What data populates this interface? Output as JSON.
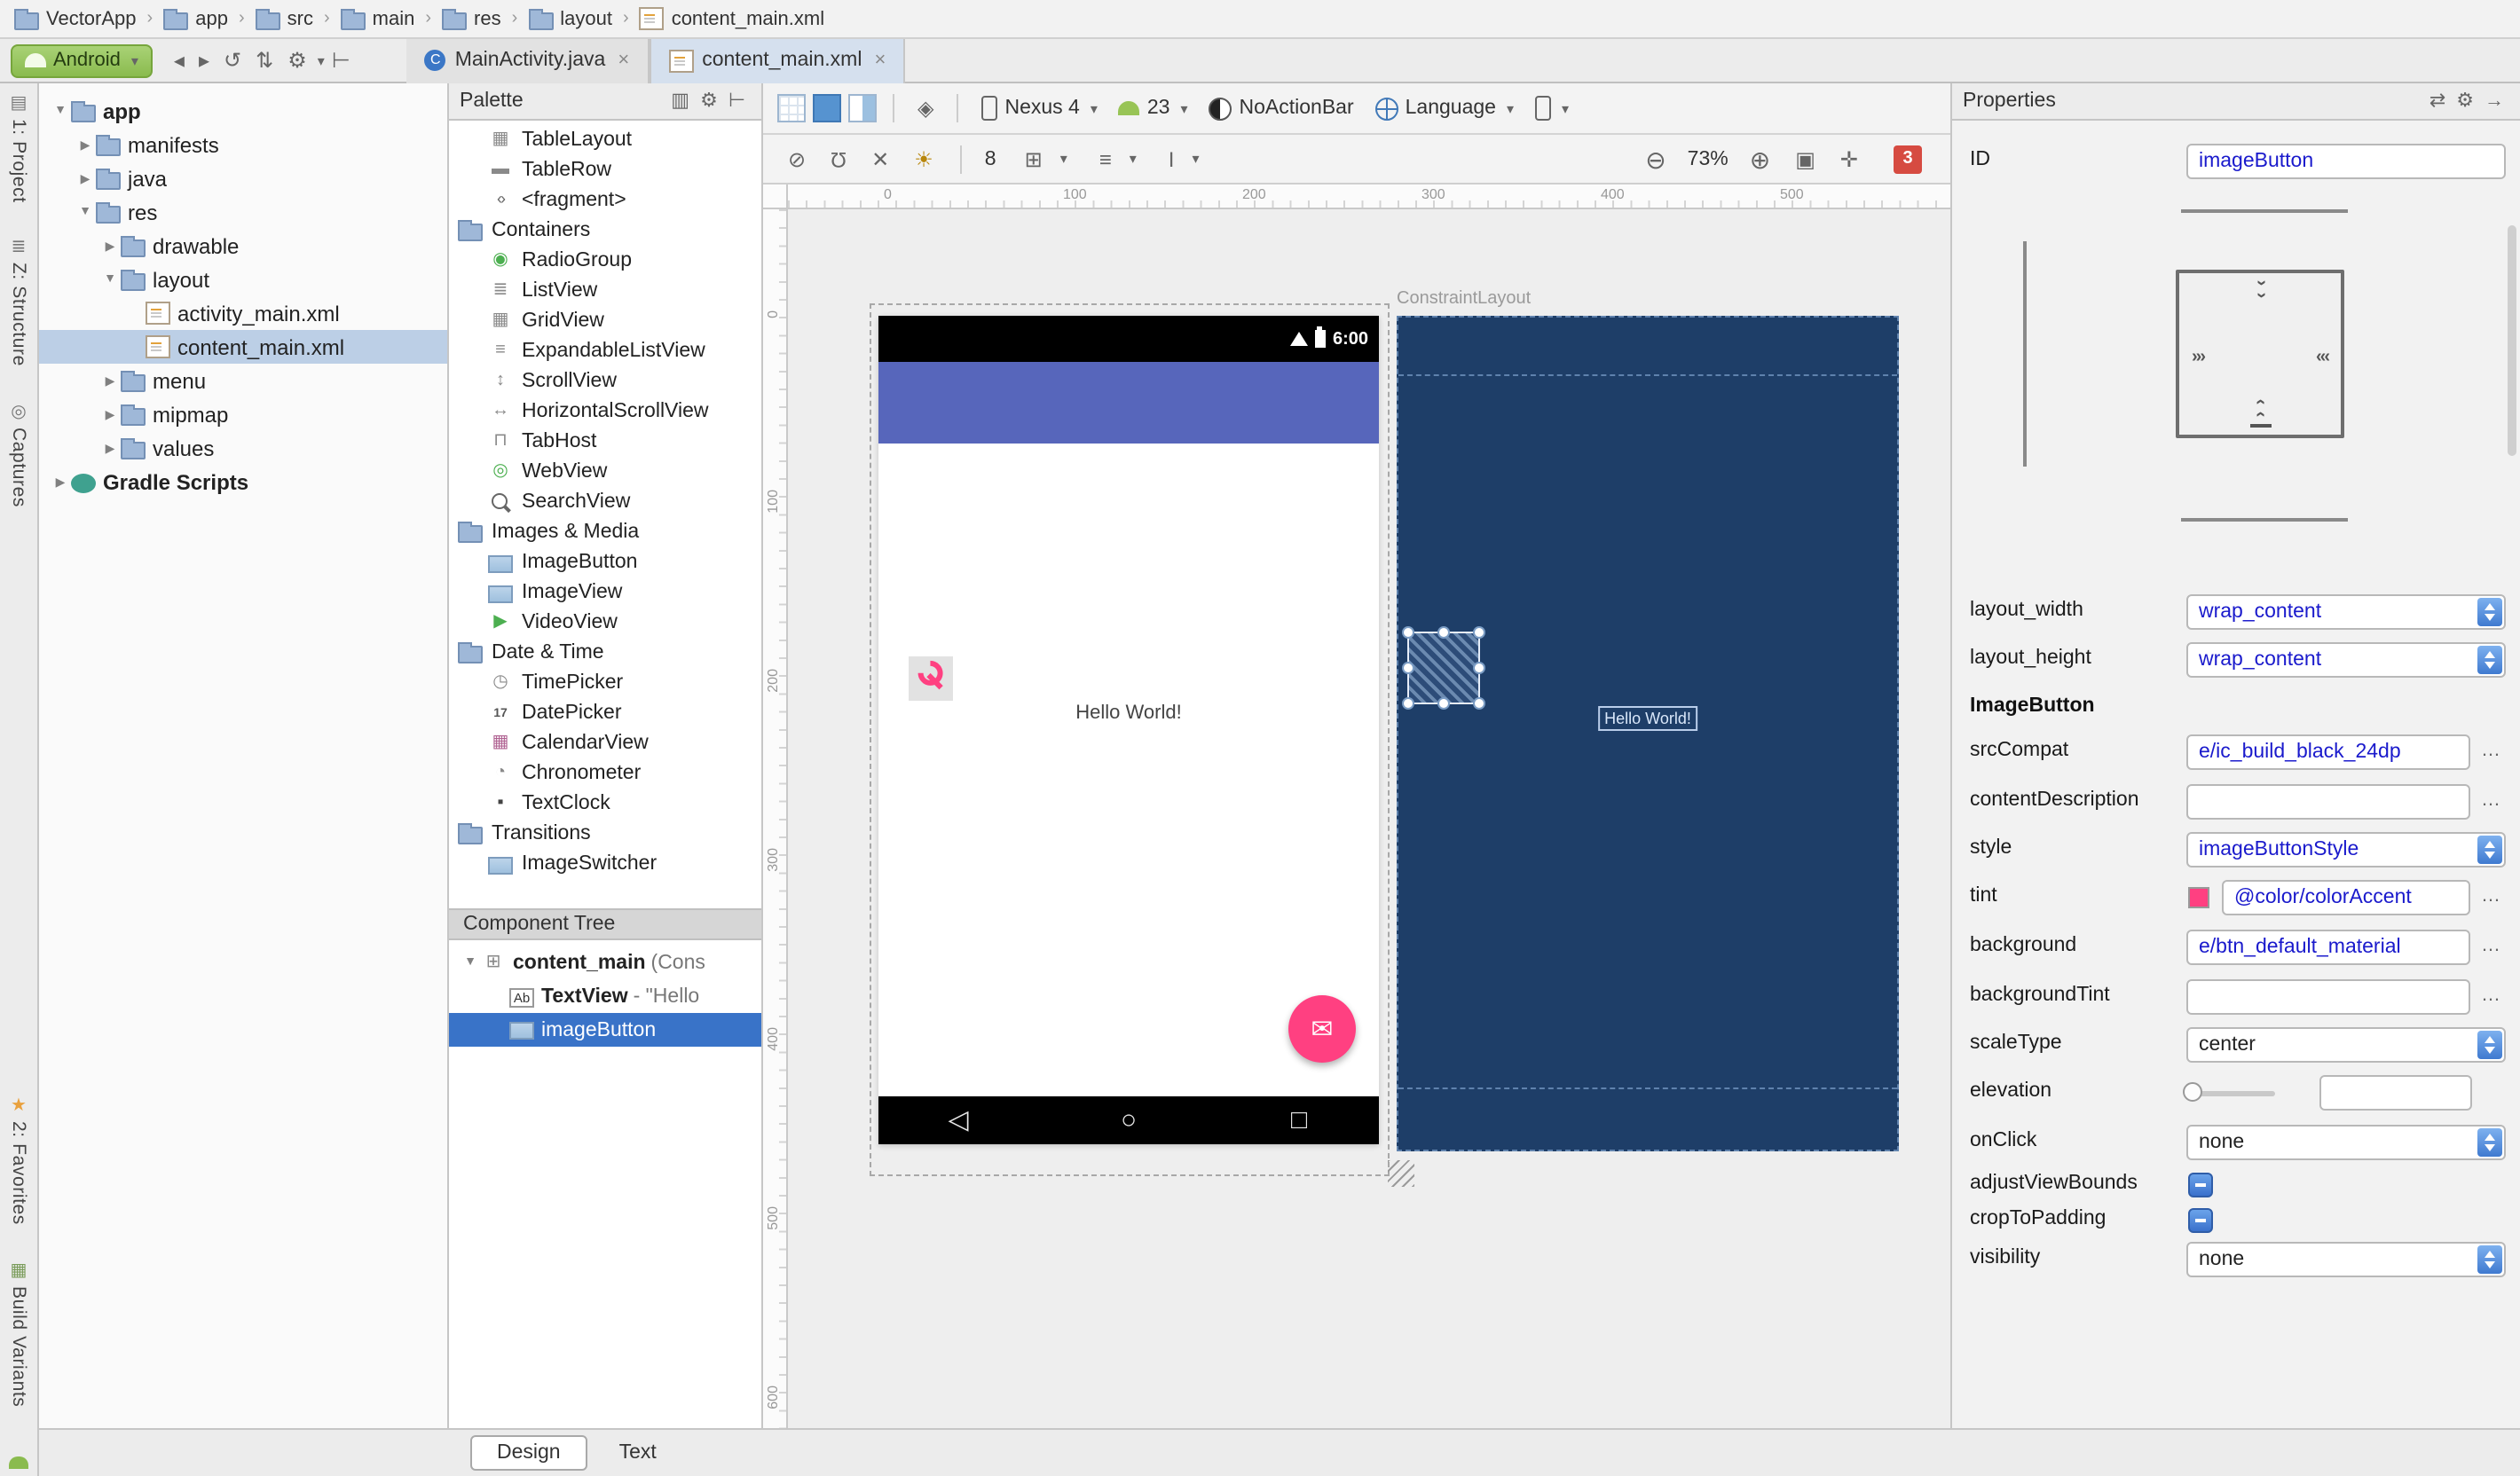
{
  "colors": {
    "accent": "#ff4081",
    "primary": "#5766bb",
    "blueprint_bg": "#1e3e68",
    "selection": "#3973c8"
  },
  "breadcrumb": {
    "items": [
      "VectorApp",
      "app",
      "src",
      "main",
      "res",
      "layout",
      "content_main.xml"
    ]
  },
  "run_widget": {
    "label": "Android"
  },
  "editor_tabs": [
    {
      "label": "MainActivity.java"
    },
    {
      "label": "content_main.xml"
    }
  ],
  "left_strip": {
    "buttons": [
      {
        "label": "1: Project",
        "icon": "project"
      },
      {
        "label": "Z: Structure",
        "icon": "structure"
      },
      {
        "label": "Captures",
        "icon": "captures"
      }
    ],
    "bottom_buttons": [
      {
        "label": "2: Favorites",
        "icon": "favorites"
      },
      {
        "label": "Build Variants",
        "icon": "build"
      }
    ]
  },
  "project_tree": {
    "items": [
      {
        "label": "app",
        "depth": 0,
        "arrow": "down",
        "icon": "folder",
        "bold": true
      },
      {
        "label": "manifests",
        "depth": 1,
        "arrow": "right",
        "icon": "folder"
      },
      {
        "label": "java",
        "depth": 1,
        "arrow": "right",
        "icon": "folder"
      },
      {
        "label": "res",
        "depth": 1,
        "arrow": "down",
        "icon": "folder"
      },
      {
        "label": "drawable",
        "depth": 2,
        "arrow": "right",
        "icon": "folder"
      },
      {
        "label": "layout",
        "depth": 2,
        "arrow": "down",
        "icon": "folder"
      },
      {
        "label": "activity_main.xml",
        "depth": 3,
        "arrow": "none",
        "icon": "xml"
      },
      {
        "label": "content_main.xml",
        "depth": 3,
        "arrow": "none",
        "icon": "xml",
        "selected": true
      },
      {
        "label": "menu",
        "depth": 2,
        "arrow": "right",
        "icon": "folder"
      },
      {
        "label": "mipmap",
        "depth": 2,
        "arrow": "right",
        "icon": "folder"
      },
      {
        "label": "values",
        "depth": 2,
        "arrow": "right",
        "icon": "folder"
      },
      {
        "label": "Gradle Scripts",
        "depth": 0,
        "arrow": "right",
        "icon": "gradle",
        "bold": true
      }
    ]
  },
  "palette": {
    "title": "Palette",
    "items": [
      {
        "label": "TableLayout",
        "icon": "table",
        "type": "item"
      },
      {
        "label": "TableRow",
        "icon": "tablerow",
        "type": "item"
      },
      {
        "label": "<fragment>",
        "icon": "fragment",
        "type": "item"
      },
      {
        "label": "Containers",
        "icon": "folder",
        "type": "folder"
      },
      {
        "label": "RadioGroup",
        "icon": "radio",
        "type": "item"
      },
      {
        "label": "ListView",
        "icon": "list",
        "type": "item"
      },
      {
        "label": "GridView",
        "icon": "grid",
        "type": "item"
      },
      {
        "label": "ExpandableListView",
        "icon": "expandable",
        "type": "item"
      },
      {
        "label": "ScrollView",
        "icon": "scroll",
        "type": "item"
      },
      {
        "label": "HorizontalScrollView",
        "icon": "hscroll",
        "type": "item"
      },
      {
        "label": "TabHost",
        "icon": "tabhost",
        "type": "item"
      },
      {
        "label": "WebView",
        "icon": "web",
        "type": "item"
      },
      {
        "label": "SearchView",
        "icon": "search",
        "type": "item"
      },
      {
        "label": "Images & Media",
        "icon": "folder",
        "type": "folder"
      },
      {
        "label": "ImageButton",
        "icon": "image",
        "type": "item"
      },
      {
        "label": "ImageView",
        "icon": "image",
        "type": "item"
      },
      {
        "label": "VideoView",
        "icon": "video",
        "type": "item"
      },
      {
        "label": "Date & Time",
        "icon": "folder",
        "type": "folder"
      },
      {
        "label": "TimePicker",
        "icon": "clock",
        "type": "item"
      },
      {
        "label": "DatePicker",
        "icon": "date",
        "type": "item"
      },
      {
        "label": "CalendarView",
        "icon": "calendar",
        "type": "item"
      },
      {
        "label": "Chronometer",
        "icon": "chrono",
        "type": "item"
      },
      {
        "label": "TextClock",
        "icon": "textclock",
        "type": "item"
      },
      {
        "label": "Transitions",
        "icon": "folder",
        "type": "folder"
      },
      {
        "label": "ImageSwitcher",
        "icon": "image",
        "type": "item"
      }
    ]
  },
  "component_tree": {
    "title": "Component Tree",
    "items": [
      {
        "name": "content_main",
        "suffix": "(Cons",
        "icon": "constraint",
        "arrow": "down",
        "depth": 0
      },
      {
        "name": "TextView",
        "suffix": "- \"Hello",
        "icon": "textview",
        "depth": 1
      },
      {
        "name": "imageButton",
        "suffix": "",
        "icon": "imagebutton",
        "depth": 1,
        "selected": true
      }
    ]
  },
  "design_toolbar": {
    "device_label": "Nexus 4",
    "api_label": "23",
    "theme_label": "NoActionBar",
    "locale_label": "Language",
    "margin_value": "8",
    "zoom_value": "73%",
    "error_count": "3"
  },
  "canvas": {
    "constraint_label": "ConstraintLayout",
    "h_ruler": [
      "0",
      "100",
      "200",
      "300",
      "400",
      "500"
    ],
    "v_ruler": [
      "0",
      "100",
      "200",
      "300",
      "400",
      "500",
      "600"
    ],
    "design_preview": {
      "time": "6:00",
      "hello_text": "Hello World!"
    },
    "blueprint_preview": {
      "hello_text": "Hello World!"
    }
  },
  "properties": {
    "title": "Properties",
    "id": {
      "label": "ID",
      "value": "imageButton"
    },
    "layout_width": {
      "label": "layout_width",
      "value": "wrap_content"
    },
    "layout_height": {
      "label": "layout_height",
      "value": "wrap_content"
    },
    "section_title": "ImageButton",
    "srcCompat": {
      "label": "srcCompat",
      "value": "e/ic_build_black_24dp"
    },
    "contentDescription": {
      "label": "contentDescription",
      "value": ""
    },
    "style": {
      "label": "style",
      "value": "imageButtonStyle"
    },
    "tint": {
      "label": "tint",
      "value": "@color/colorAccent",
      "swatch": "#ff4081"
    },
    "background": {
      "label": "background",
      "value": "e/btn_default_material"
    },
    "backgroundTint": {
      "label": "backgroundTint",
      "value": ""
    },
    "scaleType": {
      "label": "scaleType",
      "value": "center"
    },
    "elevation": {
      "label": "elevation",
      "value": ""
    },
    "onClick": {
      "label": "onClick",
      "value": "none"
    },
    "adjustViewBounds": {
      "label": "adjustViewBounds"
    },
    "cropToPadding": {
      "label": "cropToPadding"
    },
    "visibility": {
      "label": "visibility",
      "value": "none"
    }
  },
  "bottom_bar": {
    "design_tab": "Design",
    "text_tab": "Text"
  }
}
